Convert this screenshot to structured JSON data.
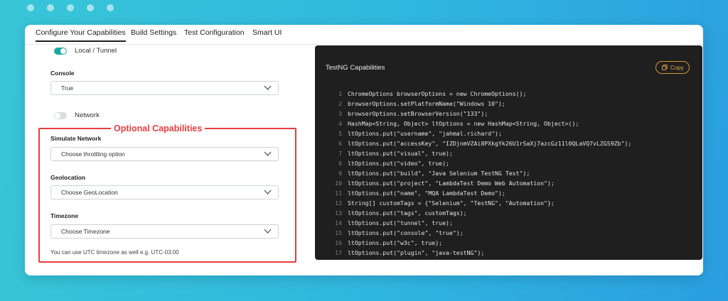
{
  "tabs": [
    {
      "label": "Configure Your Capabilities",
      "active": true
    },
    {
      "label": "Build Settings"
    },
    {
      "label": "Test Configuration"
    },
    {
      "label": "Smart UI"
    }
  ],
  "left": {
    "local_tunnel_label": "Local / Tunnel",
    "console_label": "Console",
    "console_value": "True",
    "network_label": "Network",
    "optional_title": "Optional Capabilities",
    "simulate_network_label": "Simulate Network",
    "simulate_network_value": "Choose throttling option",
    "geolocation_label": "Geolocation",
    "geolocation_value": "Choose GeoLocation",
    "timezone_label": "Timezone",
    "timezone_value": "Choose Timezone",
    "timezone_hint": "You can use UTC timezone as well e.g. UTC-03:00"
  },
  "code_panel": {
    "title": "TestNG Capabilities",
    "copy_label": "Copy",
    "lines": [
      "ChromeOptions browserOptions = new ChromeOptions();",
      "browserOptions.setPlatformName(\"Windows 10\");",
      "browserOptions.setBrowserVersion(\"133\");",
      "HashMap<String, Object> ltOptions = new HashMap<String, Object>();",
      "ltOptions.put(\"username\", \"jahmal.richard\");",
      "ltOptions.put(\"accessKey\", \"IZDjnmVZAi8PXkgYk26U1rSaXj7azcGz11l0QLaVQ7vLZGS9Zb\");",
      "ltOptions.put(\"visual\", true);",
      "ltOptions.put(\"video\", true);",
      "ltOptions.put(\"build\", \"Java Selenium TestNG Test\");",
      "ltOptions.put(\"project\", \"LambdaTest Demo Web Automation\");",
      "ltOptions.put(\"name\", \"MQA LambdaTest Demo\");",
      "String[] customTags = {\"Selenium\", \"TestNG\", \"Automation\"};",
      "ltOptions.put(\"tags\", customTags);",
      "ltOptions.put(\"tunnel\", true);",
      "ltOptions.put(\"console\", \"true\");",
      "ltOptions.put(\"w3c\", true);",
      "ltOptions.put(\"plugin\", \"java-testNG\");"
    ]
  },
  "colors": {
    "accent_teal": "#1ea6a6",
    "highlight_red": "#e53e3e",
    "copy_orange": "#d39a2f",
    "code_bg": "#1f1f1f"
  }
}
